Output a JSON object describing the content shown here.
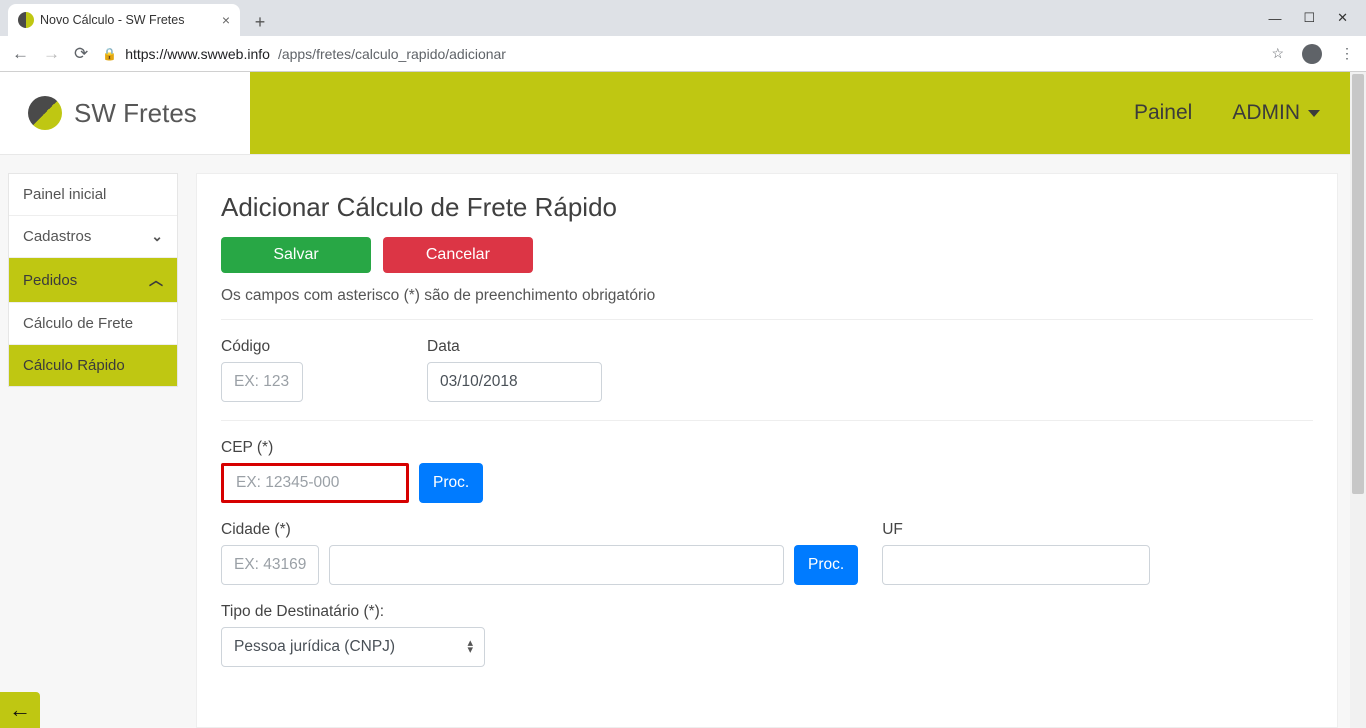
{
  "browser": {
    "tab_title": "Novo Cálculo - SW Fretes",
    "url_host": "https://www.swweb.info",
    "url_path": "/apps/fretes/calculo_rapido/adicionar"
  },
  "header": {
    "brand": "SW Fretes",
    "link_painel": "Painel",
    "link_admin": "ADMIN"
  },
  "sidebar": {
    "items": [
      {
        "label": "Painel inicial",
        "expandable": false,
        "active": false
      },
      {
        "label": "Cadastros",
        "expandable": true,
        "expanded": false,
        "active": false
      },
      {
        "label": "Pedidos",
        "expandable": true,
        "expanded": true,
        "active": true
      },
      {
        "label": "Cálculo de Frete",
        "expandable": false,
        "active": false
      },
      {
        "label": "Cálculo Rápido",
        "expandable": false,
        "active": true
      }
    ]
  },
  "page": {
    "title": "Adicionar Cálculo de Frete Rápido",
    "save_label": "Salvar",
    "cancel_label": "Cancelar",
    "hint": "Os campos com asterisco (*) são de preenchimento obrigatório",
    "codigo_label": "Código",
    "codigo_placeholder": "EX: 123",
    "data_label": "Data",
    "data_value": "03/10/2018",
    "cep_label": "CEP (*)",
    "cep_placeholder": "EX: 12345-000",
    "proc_label": "Proc.",
    "cidade_label": "Cidade (*)",
    "cidade_id_placeholder": "EX: 43169",
    "uf_label": "UF",
    "tipo_dest_label": "Tipo de Destinatário (*):",
    "tipo_dest_value": "Pessoa jurídica (CNPJ)"
  }
}
